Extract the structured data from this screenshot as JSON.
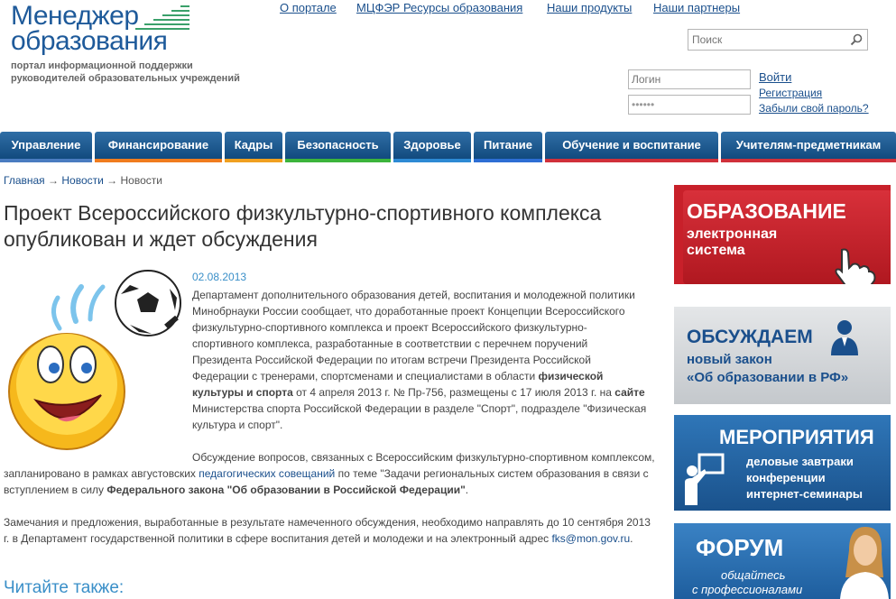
{
  "logo": {
    "line1": "Менеджер",
    "line2": "образования",
    "tagline1": "портал информационной поддержки",
    "tagline2": "руководителей образовательных учреждений"
  },
  "toplinks": [
    "О портале",
    "МЦФЭР Ресурсы образования",
    "Наши продукты",
    "Наши партнеры"
  ],
  "search": {
    "placeholder": "Поиск"
  },
  "login": {
    "login_placeholder": "Логин",
    "password_value": "••••••",
    "enter": "Войти",
    "register": "Регистрация",
    "forgot": "Забыли свой пароль?"
  },
  "nav": [
    {
      "label": "Управление",
      "color": "#4a7cc0"
    },
    {
      "label": "Финансирование",
      "color": "#f07c1e"
    },
    {
      "label": "Кадры",
      "color": "#f0a020"
    },
    {
      "label": "Безопасность",
      "color": "#3cb43c"
    },
    {
      "label": "Здоровье",
      "color": "#2d8ad4"
    },
    {
      "label": "Питание",
      "color": "#2d6ed4"
    },
    {
      "label": "Обучение и воспитание",
      "color": "#d0303a"
    },
    {
      "label": "Учителям-предметникам",
      "color": "#d0303a"
    }
  ],
  "breadcrumb": {
    "home": "Главная",
    "arrow": "→",
    "news_link": "Новости",
    "current": "Новости"
  },
  "article": {
    "title": "Проект Всероссийского физкультурно-спортивного комплекса опубликован и ждет обсуждения",
    "date": "02.08.2013",
    "p1_a": "Департамент дополнительного образования детей, воспитания и молодежной политики Минобрнауки России сообщает, что доработанные проект Концепции Всероссийского физкультурно-спортивного комплекса и проект Всероссийского физкультурно-спортивного комплекса, разработанные в соответствии с перечнем поручений Президента Российской Федерации по итогам встречи Президента Российской Федерации с тренерами, спортсменами и специалистами в области ",
    "p1_b": "физической культуры и спорта",
    "p1_c": " от 4 апреля 2013 г. № Пр-756, размещены с 17 июля 2013 г. на ",
    "p1_d": "сайте",
    "p1_e": " Министерства спорта Российской Федерации в разделе \"Спорт\", подразделе \"Физическая культура и спорт\".",
    "p2_a": "Обсуждение вопросов, связанных с Всероссийским физкультурно-спортивном комплексом, запланировано в рамках августовских ",
    "p2_link": "педагогических совещаний",
    "p2_b": " по теме \"Задачи региональных систем образования в связи с вступлением в силу ",
    "p2_c": "Федерального закона \"Об образовании в Российской Федерации\"",
    "p2_d": ".",
    "p3_a": "Замечания и предложения, выработанные в результате намеченного обсуждения, необходимо направлять до 10 сентября 2013 г. в Департамент государственной политики в сфере воспитания детей и молодежи и на электронный адрес ",
    "p3_email": "fks@mon.gov.ru",
    "p3_b": ".",
    "read_also": "Читайте также:"
  },
  "banners": {
    "b1": {
      "line1": "ОБРАЗОВАНИЕ",
      "line2": "электронная",
      "line3": "система",
      "bg": "#c8202a"
    },
    "b2": {
      "line1": "ОБСУЖДАЕМ",
      "line2": "новый закон",
      "line3": "«Об образовании в РФ»",
      "bg": "#d4d8dc"
    },
    "b3": {
      "line1": "МЕРОПРИЯТИЯ",
      "line2": "деловые завтраки",
      "line3": "конференции",
      "line4": "интернет-семинары",
      "bg": "#2a68a8"
    },
    "b4": {
      "line1": "ФОРУМ",
      "line2": "общайтесь",
      "line3": "с профессионалами",
      "bg": "#2a6cb0"
    }
  }
}
